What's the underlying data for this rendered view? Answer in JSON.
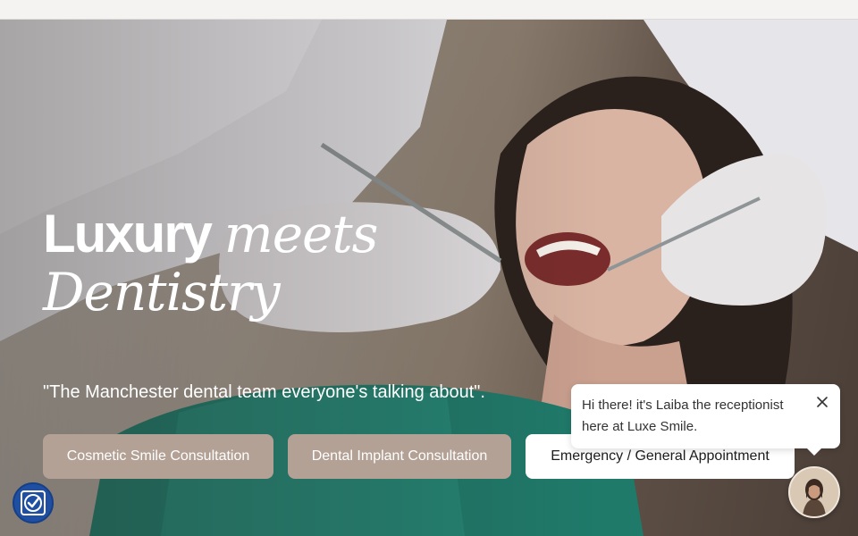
{
  "hero": {
    "headline_bold": "Luxury",
    "headline_italic_1": "meets",
    "headline_italic_2": "Dentistry",
    "tagline": "\"The Manchester dental team everyone's talking about\"."
  },
  "cta_buttons": [
    {
      "label": "Cosmetic Smile Consultation"
    },
    {
      "label": "Dental Implant Consultation"
    },
    {
      "label": "Emergency / General Appointment"
    }
  ],
  "chat": {
    "message": "Hi there! it's Laiba the receptionist here at Luxe Smile.",
    "close_icon": "close-icon",
    "avatar_icon": "receptionist-avatar"
  },
  "accessibility": {
    "icon": "accessibility-icon"
  },
  "colors": {
    "cta_tan": "#b4a195",
    "cta_white": "#ffffff",
    "accessibility_blue": "#1f4fa3"
  }
}
